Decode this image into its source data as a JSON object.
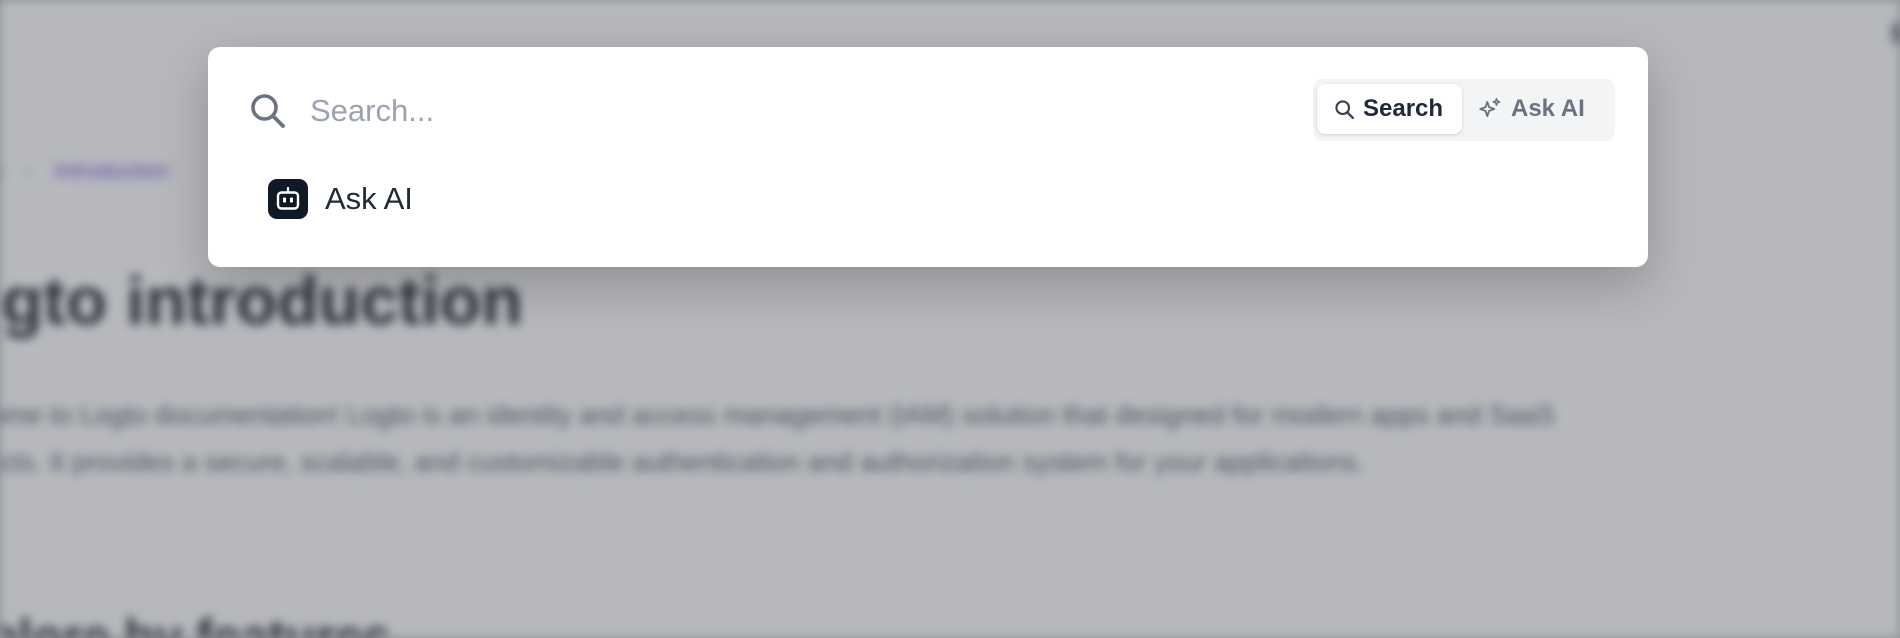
{
  "background": {
    "breadcrumb": [
      "s",
      "Introduction"
    ],
    "title": "ogto introduction",
    "paragraph_lines": [
      "lcome to Logto documentation! Logto is an identity and access management (IAM) solution that designed for modern apps and SaaS",
      "ducts. It provides a secure, scalable, and customizable authentication and authorization system for your applications."
    ],
    "subtitle": "xplore by features"
  },
  "search": {
    "icon": "search-icon",
    "placeholder": "Search..."
  },
  "mode_switch": {
    "search_label": "Search",
    "ask_ai_label": "Ask AI",
    "active": "Search"
  },
  "results": [
    {
      "icon": "robot-icon",
      "label": "Ask AI"
    }
  ],
  "colors": {
    "overlay": "#50566066",
    "modal_bg": "#ffffff",
    "accent": "#6d4ae8",
    "robot_icon_bg": "#111827"
  }
}
